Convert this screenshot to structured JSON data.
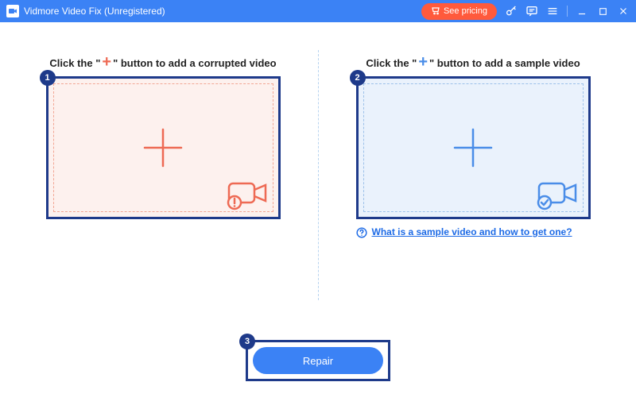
{
  "titlebar": {
    "title": "Vidmore Video Fix (Unregistered)",
    "pricing_label": "See pricing"
  },
  "panels": {
    "left": {
      "title_pre": "Click the \"",
      "title_post": "\" button to add a corrupted video",
      "step": "1"
    },
    "right": {
      "title_pre": "Click the \"",
      "title_post": "\" button to add a sample video",
      "step": "2",
      "help_text": "What is a sample video and how to get one?"
    }
  },
  "repair": {
    "step": "3",
    "label": "Repair"
  },
  "colors": {
    "accent_orange": "#ee6a54",
    "accent_blue": "#4a8de8",
    "annotation_navy": "#1e3a8a"
  }
}
